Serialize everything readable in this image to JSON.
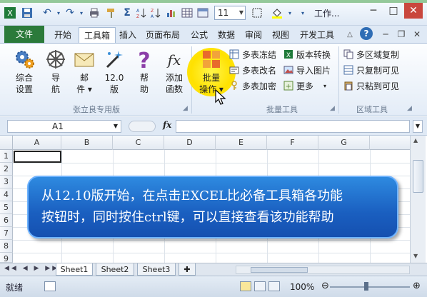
{
  "title_bar": {
    "font_size": "11",
    "window_title": "工作..."
  },
  "tabs": [
    "文件",
    "开始",
    "工具箱",
    "插入",
    "页面布局",
    "公式",
    "数据",
    "审阅",
    "视图",
    "开发工具"
  ],
  "ribbon": {
    "group1": {
      "label": "张立良专用版",
      "buttons": [
        {
          "label1": "综合",
          "label2": "设置",
          "icon": "settings-gear-icon"
        },
        {
          "label1": "导",
          "label2": "航",
          "icon": "compass-icon"
        },
        {
          "label1": "邮",
          "label2": "件 ▾",
          "icon": "envelope-icon"
        },
        {
          "label1": "12.0",
          "label2": "版",
          "icon": "magic-wand-icon"
        },
        {
          "label1": "帮",
          "label2": "助",
          "icon": "question-mark-icon"
        },
        {
          "label1": "添加",
          "label2": "函数",
          "icon": "fx-icon"
        }
      ]
    },
    "group2": {
      "label": "批量工具",
      "big_button": {
        "label1": "批量",
        "label2": "操作 ▾"
      },
      "small_buttons": [
        "多表冻结",
        "多表改名",
        "多表加密",
        "版本转换",
        "导入图片",
        "更多"
      ]
    },
    "group3": {
      "label": "区域工具",
      "small_buttons": [
        "多区域复制",
        "只复制可见",
        "只粘到可见"
      ]
    }
  },
  "formula_bar": {
    "name_box": "A1",
    "fx": "fx",
    "formula": ""
  },
  "grid": {
    "columns": [
      "A",
      "B",
      "C",
      "D",
      "E",
      "F",
      "G"
    ],
    "rows": [
      "1",
      "2",
      "3",
      "4",
      "5",
      "6",
      "7",
      "8",
      "9"
    ]
  },
  "callout": {
    "line1": "从12.10版开始，在点击EXCEL比必备工具箱各功能",
    "line2": "按钮时，同时按住ctrl键，可以直接查看该功能帮助"
  },
  "sheets": [
    "Sheet1",
    "Sheet2",
    "Sheet3"
  ],
  "status": {
    "text": "就绪",
    "zoom": "100%"
  },
  "colors": {
    "file_tab": "#2b7a3a",
    "callout": "#1a5fc0",
    "highlight": "#ffe100"
  }
}
